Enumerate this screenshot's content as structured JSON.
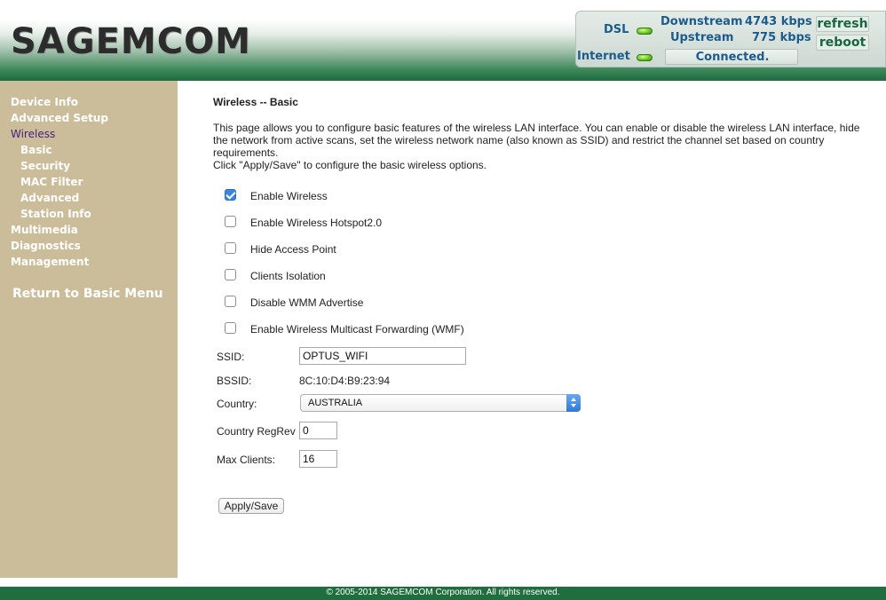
{
  "header": {
    "brand": "SAGEMCOM",
    "status": {
      "dsl_label": "DSL",
      "internet_label": "Internet",
      "downstream_label": "Downstream",
      "downstream_value": "4743 kbps",
      "upstream_label": "Upstream",
      "upstream_value": "775 kbps",
      "connection": "Connected.",
      "led_color": "#5fc21a"
    },
    "refresh_label": "refresh",
    "reboot_label": "reboot"
  },
  "sidebar": {
    "items": [
      {
        "label": "Device Info"
      },
      {
        "label": "Advanced Setup"
      },
      {
        "label": "Wireless"
      },
      {
        "label": "Basic"
      },
      {
        "label": "Security"
      },
      {
        "label": "MAC Filter"
      },
      {
        "label": "Advanced"
      },
      {
        "label": "Station Info"
      },
      {
        "label": "Multimedia"
      },
      {
        "label": "Diagnostics"
      },
      {
        "label": "Management"
      }
    ],
    "return_label": "Return to Basic Menu",
    "active_item": "Wireless"
  },
  "main": {
    "title": "Wireless -- Basic",
    "description": "This page allows you to configure basic features of the wireless LAN interface. You can enable or disable the wireless LAN interface, hide the network from active scans, set the wireless network name (also known as SSID) and restrict the channel set based on country requirements.",
    "description2": "Click \"Apply/Save\" to configure the basic wireless options.",
    "options": [
      {
        "label": "Enable Wireless",
        "checked": true
      },
      {
        "label": "Enable Wireless Hotspot2.0",
        "checked": false
      },
      {
        "label": "Hide Access Point",
        "checked": false
      },
      {
        "label": "Clients Isolation",
        "checked": false
      },
      {
        "label": "Disable WMM Advertise",
        "checked": false
      },
      {
        "label": "Enable Wireless Multicast Forwarding (WMF)",
        "checked": false
      }
    ],
    "ssid_label": "SSID:",
    "ssid_value": "OPTUS_WIFI",
    "bssid_label": "BSSID:",
    "bssid_value": "8C:10:D4:B9:23:94",
    "country_label": "Country:",
    "country_value": "AUSTRALIA",
    "regrev_label": "Country RegRev",
    "regrev_value": "0",
    "maxclients_label": "Max Clients:",
    "maxclients_value": "16",
    "apply_label": "Apply/Save"
  },
  "footer": {
    "text": "© 2005-2014 SAGEMCOM Corporation. All rights reserved."
  },
  "colors": {
    "header_green": "#1d6a3c",
    "sidebar_bg": "#cbbd99",
    "active_nav": "#4a227a",
    "status_text": "#1c5c8c"
  }
}
